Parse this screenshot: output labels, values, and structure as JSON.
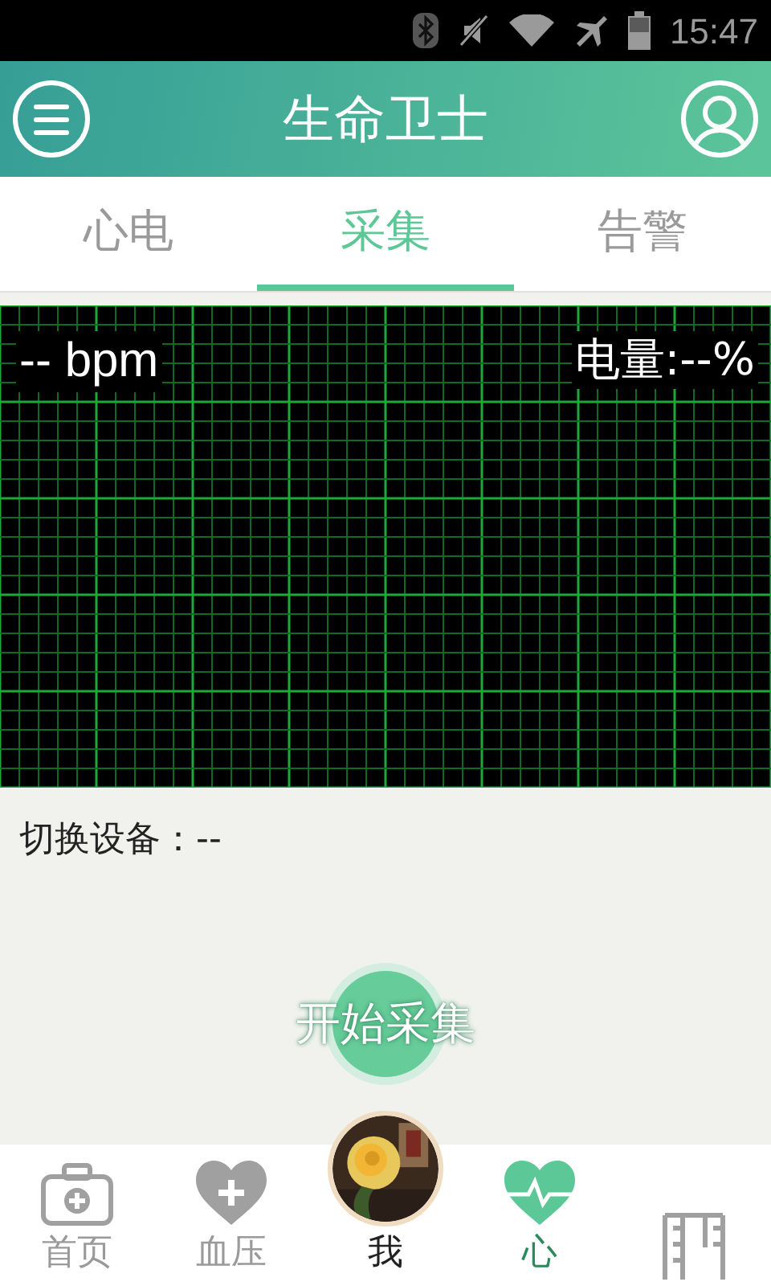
{
  "status_bar": {
    "time": "15:47"
  },
  "header": {
    "title": "生命卫士"
  },
  "tabs": [
    {
      "label": "心电",
      "selected": false
    },
    {
      "label": "采集",
      "selected": true
    },
    {
      "label": "告警",
      "selected": false
    }
  ],
  "monitor": {
    "heart_rate": "-- bpm",
    "battery": "电量:--%"
  },
  "device": {
    "label": "切换设备：--"
  },
  "start_button": {
    "label": "开始采集"
  },
  "bottom_nav": [
    {
      "kind": "kit",
      "label": "首页",
      "selected": false
    },
    {
      "kind": "heart-plus",
      "label": "血压",
      "selected": false
    },
    {
      "kind": "avatar",
      "label": "我",
      "selected": false
    },
    {
      "kind": "heart-pulse",
      "label": "心",
      "selected": true
    },
    {
      "kind": "ruler",
      "selected": false
    }
  ]
}
